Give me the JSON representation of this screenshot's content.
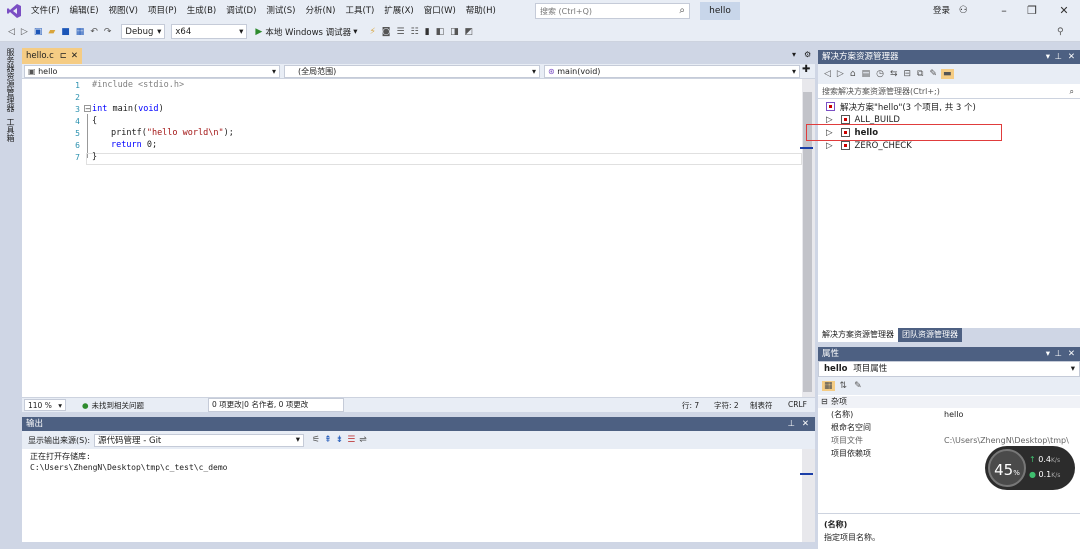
{
  "menubar": {
    "items": [
      "文件(F)",
      "编辑(E)",
      "视图(V)",
      "项目(P)",
      "生成(B)",
      "调试(D)",
      "测试(S)",
      "分析(N)",
      "工具(T)",
      "扩展(X)",
      "窗口(W)",
      "帮助(H)"
    ],
    "search_placeholder": "搜索 (Ctrl+Q)",
    "title": "hello",
    "login": "登录"
  },
  "toolbar": {
    "config": "Debug",
    "platform": "x64",
    "run_label": "本地 Windows 调试器"
  },
  "left_strip": {
    "server_explorer": "服务器资源管理器",
    "toolbox": "工具箱"
  },
  "editor": {
    "tab_name": "hello.c",
    "nav_project": "hello",
    "nav_scope": "(全局范围)",
    "nav_member": "main(void)",
    "line_numbers": [
      "1",
      "2",
      "3",
      "4",
      "5",
      "6",
      "7"
    ],
    "code_include": "#include <stdio.h>",
    "code_int": "int",
    "code_main": " main(",
    "code_void": "void",
    "code_close_paren": ")",
    "code_open_brace": "{",
    "code_printf": "printf(",
    "code_str": "\"hello world\\n\"",
    "code_end": ");",
    "code_return": "return",
    "code_zero": " 0;",
    "code_close_brace": "}"
  },
  "status_bar": {
    "zoom": "110 %",
    "issues": "未找到相关问题",
    "changes": "0 项更改|0 名作者, 0 项更改",
    "line": "行: 7",
    "char": "字符: 2",
    "tabs": "制表符",
    "eol": "CRLF"
  },
  "output": {
    "title": "输出",
    "source_label": "显示输出来源(S):",
    "source_value": "源代码管理 - Git",
    "lines": [
      "正在打开存储库:",
      "C:\\Users\\ZhengN\\Desktop\\tmp\\c_test\\c_demo"
    ]
  },
  "solution_explorer": {
    "title": "解决方案资源管理器",
    "search_placeholder": "搜索解决方案资源管理器(Ctrl+;)",
    "root": "解决方案\"hello\"(3 个项目, 共 3 个)",
    "items": [
      "ALL_BUILD",
      "hello",
      "ZERO_CHECK"
    ],
    "tab_solution": "解决方案资源管理器",
    "tab_team": "团队资源管理器"
  },
  "properties": {
    "title": "属性",
    "object_name": "hello",
    "object_type": "项目属性",
    "category": "杂项",
    "rows": [
      {
        "key": "(名称)",
        "value": "hello"
      },
      {
        "key": "根命名空间",
        "value": ""
      },
      {
        "key": "项目文件",
        "value": "C:\\Users\\ZhengN\\Desktop\\tmp\\"
      },
      {
        "key": "项目依赖项",
        "value": ""
      }
    ],
    "desc_title": "(名称)",
    "desc_text": "指定项目名称。"
  },
  "speed_widget": {
    "percent": "45",
    "unit": "%",
    "up": "0.4",
    "down": "0.1",
    "rate_unit": "K/s"
  },
  "colors": {
    "accent_header": "#4d6082",
    "active_tab": "#f5cc84",
    "highlight_box": "#e03c3c"
  }
}
